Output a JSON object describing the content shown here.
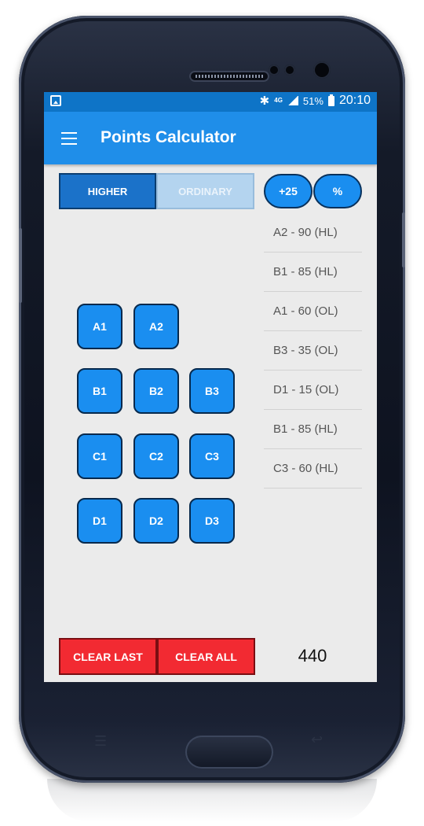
{
  "status_bar": {
    "network": "4G",
    "battery": "51%",
    "time": "20:10"
  },
  "app_bar": {
    "title": "Points Calculator"
  },
  "level_toggle": {
    "higher_label": "HIGHER",
    "ordinary_label": "ORDINARY",
    "selected": "HIGHER"
  },
  "actions": {
    "bonus_label": "+25",
    "percent_label": "%"
  },
  "grades": [
    [
      "A1",
      "A2"
    ],
    [
      "B1",
      "B2",
      "B3"
    ],
    [
      "C1",
      "C2",
      "C3"
    ],
    [
      "D1",
      "D2",
      "D3"
    ]
  ],
  "results": [
    "A2 - 90 (HL)",
    "B1 - 85 (HL)",
    "A1 - 60 (OL)",
    "B3 - 35 (OL)",
    "D1 - 15 (OL)",
    "B1 - 85 (HL)",
    "C3 - 60 (HL)"
  ],
  "footer": {
    "clear_last_label": "CLEAR LAST",
    "clear_all_label": "CLEAR ALL",
    "total": "440"
  },
  "colors": {
    "app_bar": "#1f8ee9",
    "status_bar": "#0e74c7",
    "grade_button": "#1a8ef0",
    "clear_button": "#f22a32",
    "screen_background": "#ebebeb"
  }
}
